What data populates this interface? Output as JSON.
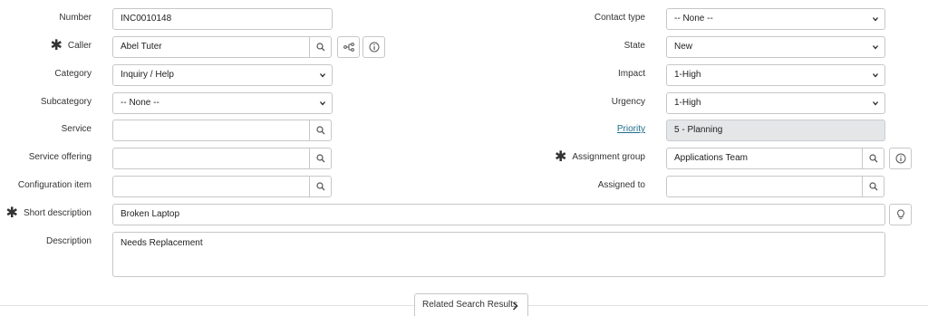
{
  "form": {
    "left": {
      "number": {
        "label": "Number",
        "value": "INC0010148"
      },
      "caller": {
        "label": "Caller",
        "value": "Abel Tuter"
      },
      "category": {
        "label": "Category",
        "value": "Inquiry / Help"
      },
      "subcategory": {
        "label": "Subcategory",
        "value": "-- None --"
      },
      "service": {
        "label": "Service",
        "value": ""
      },
      "service_offering": {
        "label": "Service offering",
        "value": ""
      },
      "configuration_item": {
        "label": "Configuration item",
        "value": ""
      },
      "short_description": {
        "label": "Short description",
        "value": "Broken Laptop"
      },
      "description": {
        "label": "Description",
        "value": "Needs Replacement"
      }
    },
    "right": {
      "contact_type": {
        "label": "Contact type",
        "value": "-- None --"
      },
      "state": {
        "label": "State",
        "value": "New"
      },
      "impact": {
        "label": "Impact",
        "value": "1-High"
      },
      "urgency": {
        "label": "Urgency",
        "value": "1-High"
      },
      "priority": {
        "label": "Priority",
        "value": "5 - Planning"
      },
      "assignment_group": {
        "label": "Assignment group",
        "value": "Applications Team"
      },
      "assigned_to": {
        "label": "Assigned to",
        "value": ""
      }
    }
  },
  "related_search": {
    "label": "Related Search Results"
  },
  "icons": [
    "search-icon",
    "dependency-icon",
    "info-icon",
    "chevron-down-icon",
    "lightbulb-icon",
    "chevron-right-icon"
  ],
  "colors": {
    "link": "#1f6f8b",
    "readonly_bg": "#e4e6e8",
    "border": "#c7c7c7"
  }
}
